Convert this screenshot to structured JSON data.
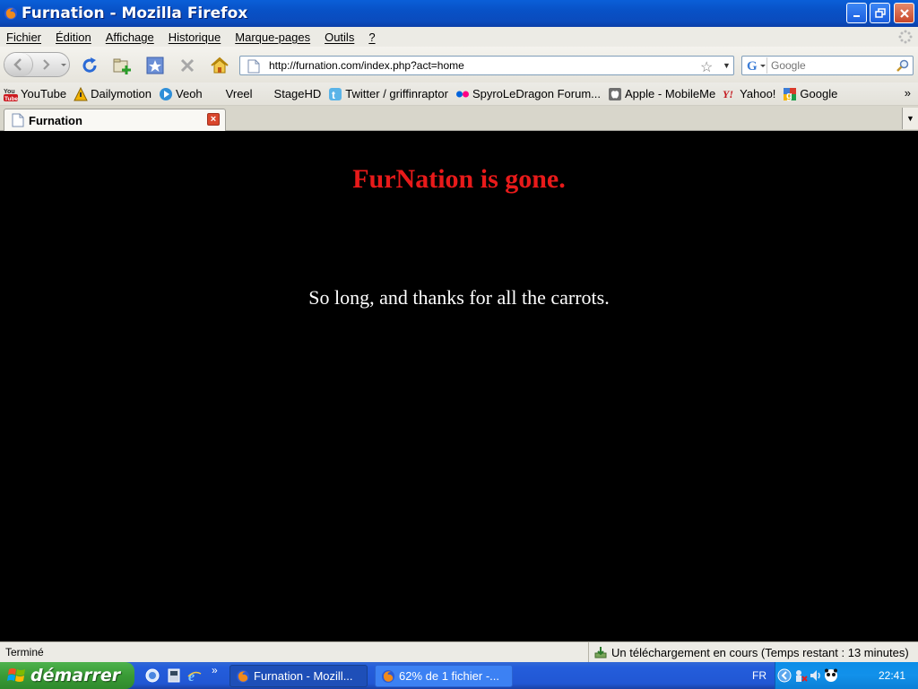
{
  "window": {
    "title": "Furnation - Mozilla Firefox"
  },
  "menubar": {
    "items": [
      "Fichier",
      "Édition",
      "Affichage",
      "Historique",
      "Marque-pages",
      "Outils",
      "?"
    ]
  },
  "navbar": {
    "url": "http://furnation.com/index.php?act=home",
    "search_placeholder": "Google"
  },
  "bookmarks": [
    {
      "label": "YouTube",
      "icon": "youtube-icon",
      "color": "#cc181e"
    },
    {
      "label": "Dailymotion",
      "icon": "dailymotion-icon",
      "color": "#f2b200"
    },
    {
      "label": "Veoh",
      "icon": "veoh-icon",
      "color": "#2f8fd8"
    },
    {
      "label": "Vreel",
      "icon": "",
      "color": ""
    },
    {
      "label": "StageHD",
      "icon": "",
      "color": ""
    },
    {
      "label": "Twitter / griffinraptor",
      "icon": "twitter-icon",
      "color": "#5ab4e8"
    },
    {
      "label": "SpyroLeDragon Forum...",
      "icon": "flickr-icon",
      "color": "#0063dc"
    },
    {
      "label": "Apple - MobileMe",
      "icon": "apple-icon",
      "color": "#888888"
    },
    {
      "label": "Yahoo!",
      "icon": "yahoo-icon",
      "color": "#c4161c"
    },
    {
      "label": "Google",
      "icon": "google-icon",
      "color": "#3c7dd6"
    }
  ],
  "tab": {
    "label": "Furnation"
  },
  "content": {
    "heading": "FurNation is gone.",
    "message": "So long, and thanks for all the carrots.",
    "heading_color": "#e81a1a"
  },
  "statusbar": {
    "status": "Terminé",
    "download": "Un téléchargement en cours (Temps restant : 13 minutes)"
  },
  "taskbar": {
    "start_label": "démarrer",
    "tasks": [
      {
        "label": "Furnation - Mozill...",
        "active": true
      },
      {
        "label": "62% de 1 fichier -...",
        "active": false
      }
    ],
    "lang": "FR",
    "clock": "22:41"
  }
}
